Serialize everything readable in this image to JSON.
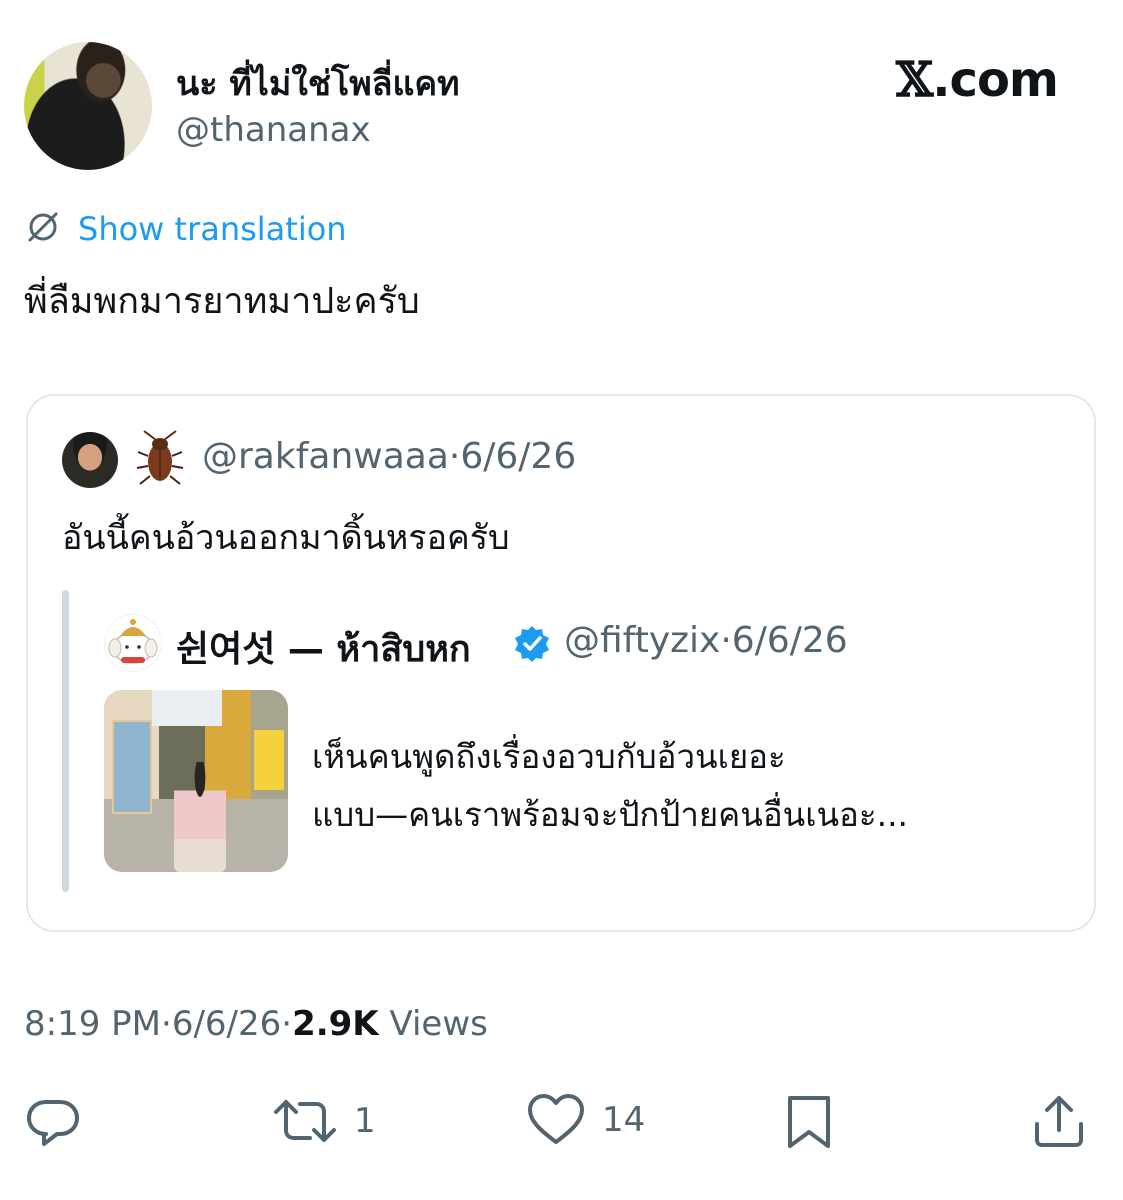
{
  "header": {
    "display_name": "นะ ที่ไม่ใช่โพลี่แคท",
    "handle": "@thananax",
    "site": "X.com",
    "site_glyph": "𝕏",
    "site_suffix": ".com"
  },
  "translation": {
    "label": "Show translation",
    "icon": "translate-globe-icon"
  },
  "tweet": {
    "text": "พี่ลืมพกมารยาทมาปะครับ"
  },
  "quote": {
    "handle": "@rakfanwaaa",
    "separator": "·",
    "date": "6/6/26",
    "emoji": "cockroach",
    "text": "อันนี้คนอ้วนออกมาดิ้นหรอครับ",
    "nested": {
      "name": "쉰여섯 — ห้าสิบหก",
      "verified": true,
      "handle": "@fiftyzix",
      "separator": "·",
      "date": "6/6/26",
      "text_line1": "เห็นคนพูดถึงเรื่องอวบกับอ้วนเยอะ",
      "text_line2": "แบบ—คนเราพร้อมจะปักป้ายคนอื่นเนอะ..."
    }
  },
  "meta": {
    "time": "8:19 PM",
    "separator": "·",
    "date": "6/6/26",
    "views_count": "2.9K",
    "views_label": "Views"
  },
  "actions": {
    "reply": {
      "icon": "reply-icon"
    },
    "retweet": {
      "icon": "retweet-icon",
      "count": "1"
    },
    "like": {
      "icon": "heart-icon",
      "count": "14"
    },
    "bookmark": {
      "icon": "bookmark-icon"
    },
    "share": {
      "icon": "share-icon"
    }
  },
  "colors": {
    "accent": "#1d9bf0",
    "muted": "#536471",
    "text": "#0f1419",
    "border": "#e1e8ed"
  }
}
